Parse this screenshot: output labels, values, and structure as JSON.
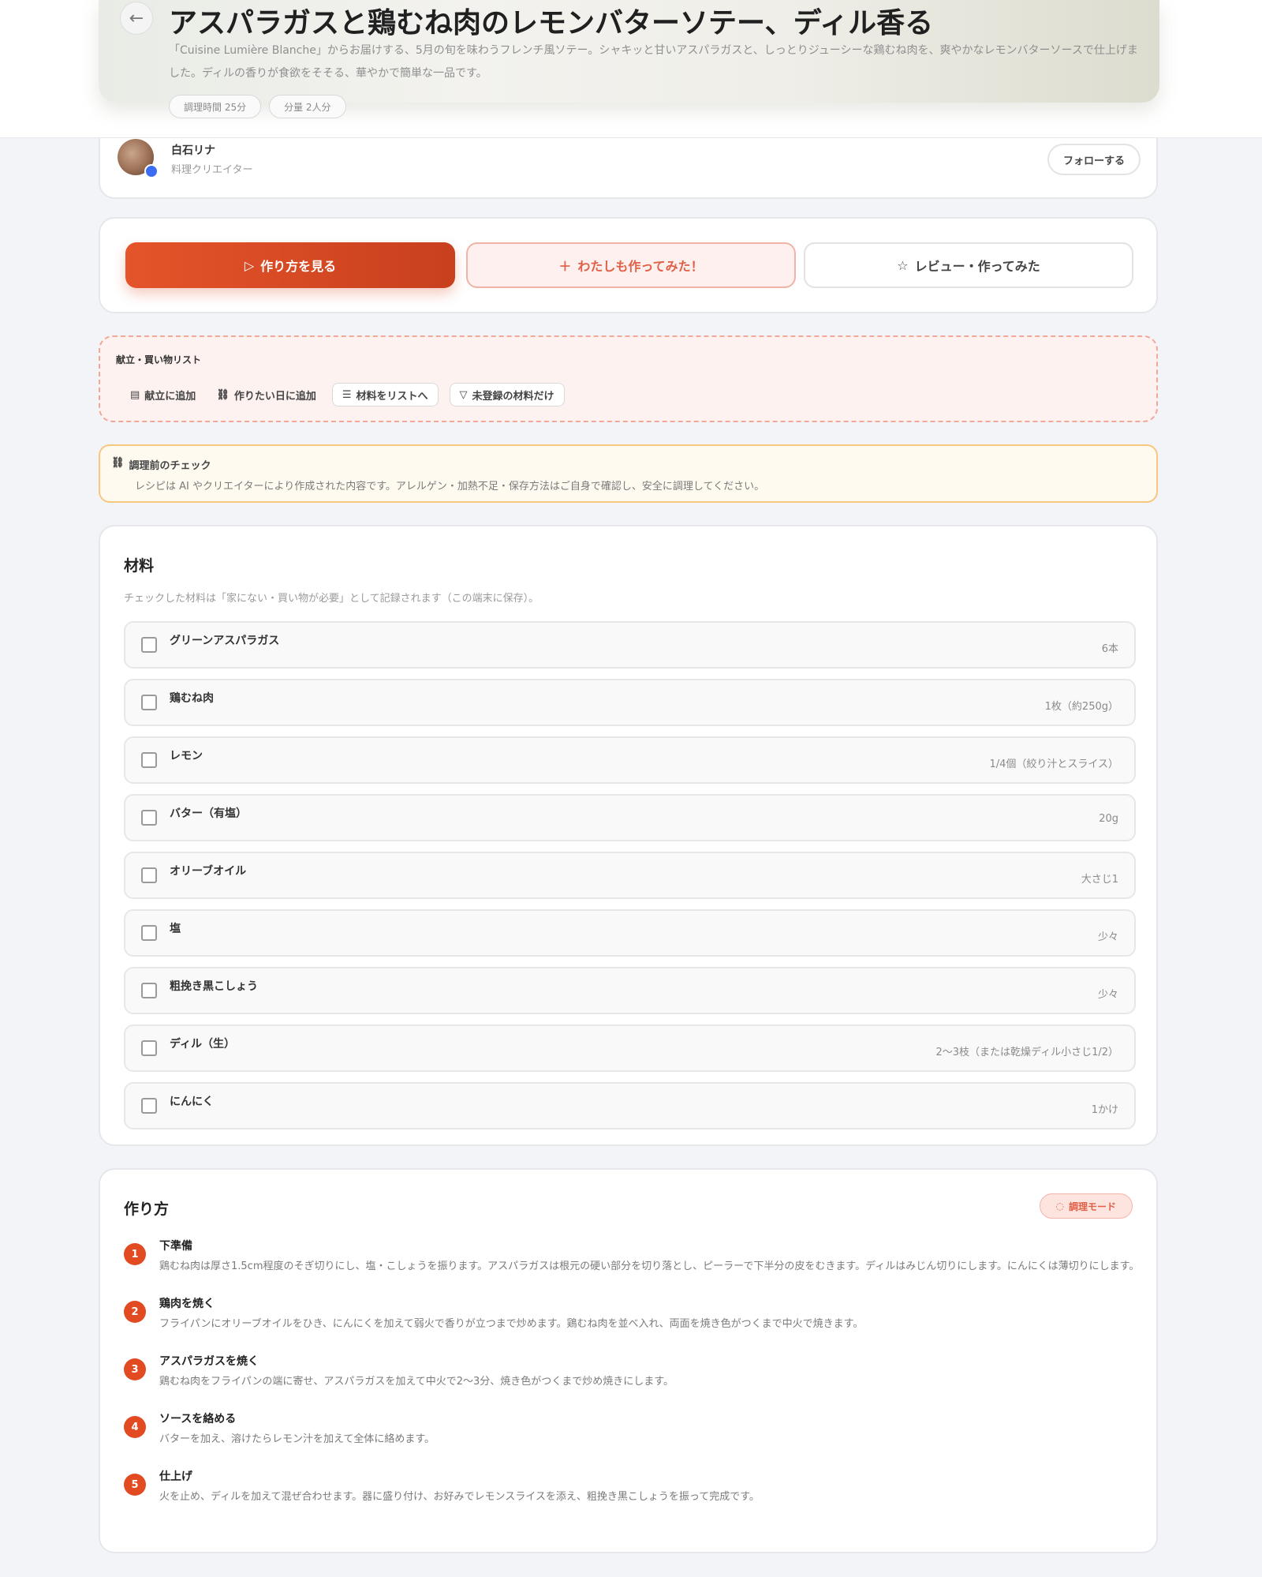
{
  "header": {
    "title": "アスパラガスと鶏むね肉のレモンバターソテー、ディル香る",
    "description": "「Cuisine Lumière Blanche」からお届けする、5月の旬を味わうフレンチ風ソテー。シャキッと甘いアスパラガスと、しっとりジューシーな鶏むね肉を、爽やかなレモンバターソースで仕上げました。ディルの香りが食欲をそそる、華やかで簡単な一品です。",
    "chips": [
      "調理時間 25分",
      "分量 2人分"
    ]
  },
  "author": {
    "name": "白石リナ",
    "role": "料理クリエイター",
    "follow_label": "フォローする"
  },
  "actions": {
    "primary": "作り方を見る",
    "secondary": "わたしも作ってみた！",
    "tertiary": "レビュー・作ってみた"
  },
  "plan": {
    "title": "献立・買い物リスト",
    "items": [
      "献立に追加",
      "作りたい日に追加",
      "材料をリストへ",
      "未登録の材料だけ"
    ]
  },
  "warning": {
    "title": "調理前のチェック",
    "text": "レシピは AI やクリエイターにより作成された内容です。アレルゲン・加熱不足・保存方法はご自身で確認し、安全に調理してください。"
  },
  "ingredients": {
    "title": "材料",
    "note": "チェックした材料は「家にない・買い物が必要」として記録されます（この端末に保存）。",
    "items": [
      {
        "name": "グリーンアスパラガス",
        "qty": "6本"
      },
      {
        "name": "鶏むね肉",
        "qty": "1枚（約250g）"
      },
      {
        "name": "レモン",
        "qty": "1/4個（絞り汁とスライス）"
      },
      {
        "name": "バター（有塩）",
        "qty": "20g"
      },
      {
        "name": "オリーブオイル",
        "qty": "大さじ1"
      },
      {
        "name": "塩",
        "qty": "少々"
      },
      {
        "name": "粗挽き黒こしょう",
        "qty": "少々"
      },
      {
        "name": "ディル（生）",
        "qty": "2〜3枝（または乾燥ディル小さじ1/2）"
      },
      {
        "name": "にんにく",
        "qty": "1かけ"
      }
    ]
  },
  "steps": {
    "title": "作り方",
    "timer_label": "調理モード",
    "items": [
      {
        "num": "1",
        "title": "下準備",
        "text": "鶏むね肉は厚さ1.5cm程度のそぎ切りにし、塩・こしょうを振ります。アスパラガスは根元の硬い部分を切り落とし、ピーラーで下半分の皮をむきます。ディルはみじん切りにします。にんにくは薄切りにします。"
      },
      {
        "num": "2",
        "title": "鶏肉を焼く",
        "text": "フライパンにオリーブオイルをひき、にんにくを加えて弱火で香りが立つまで炒めます。鶏むね肉を並べ入れ、両面を焼き色がつくまで中火で焼きます。"
      },
      {
        "num": "3",
        "title": "アスパラガスを焼く",
        "text": "鶏むね肉をフライパンの端に寄せ、アスパラガスを加えて中火で2〜3分、焼き色がつくまで炒め焼きにします。"
      },
      {
        "num": "4",
        "title": "ソースを絡める",
        "text": "バターを加え、溶けたらレモン汁を加えて全体に絡めます。"
      },
      {
        "num": "5",
        "title": "仕上げ",
        "text": "火を止め、ディルを加えて混ぜ合わせます。器に盛り付け、お好みでレモンスライスを添え、粗挽き黒こしょうを振って完成です。"
      }
    ]
  }
}
